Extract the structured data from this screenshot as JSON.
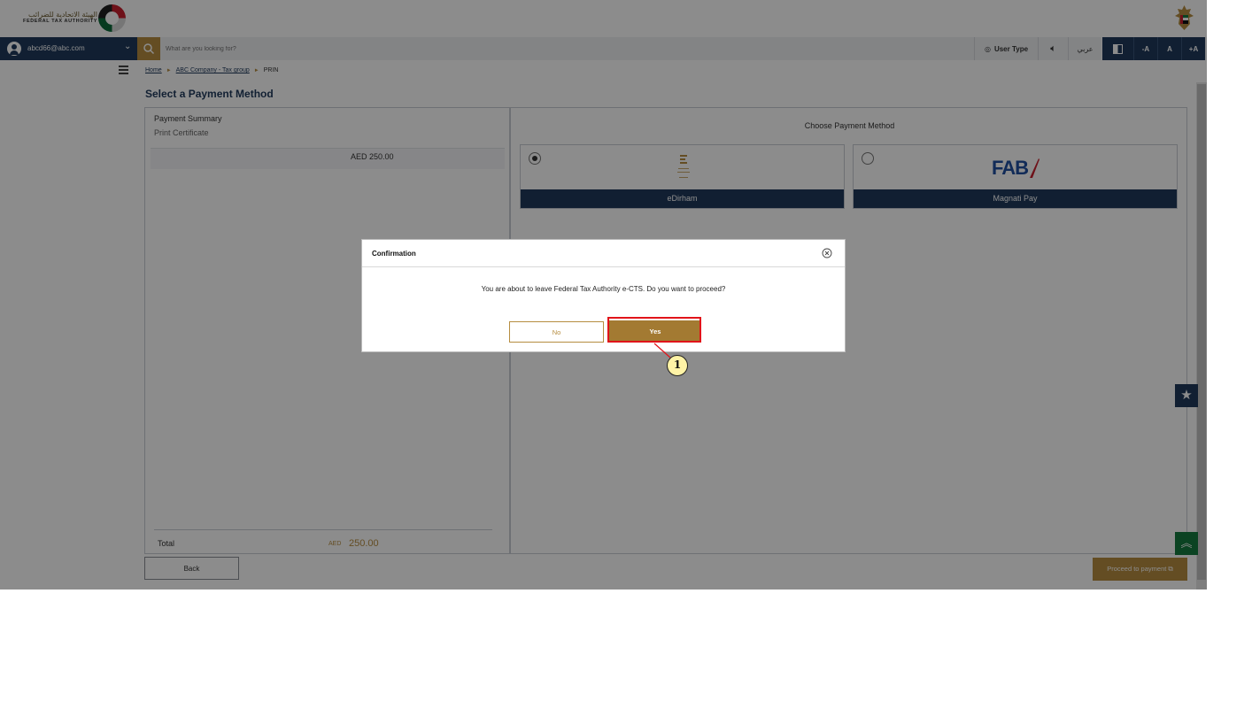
{
  "header": {
    "logo_arabic": "الهيئة الاتحادية للضرائب",
    "logo_english": "FEDERAL TAX AUTHORITY"
  },
  "navbar": {
    "user_email": "abcd66@abc.com",
    "search_placeholder": "What are you looking for?",
    "user_type_label": "User Type",
    "language_label": "عربي",
    "font_decrease": "-A",
    "font_normal": "A",
    "font_increase": "+A"
  },
  "breadcrumb": {
    "items": [
      "Home",
      "ABC Company - Tax group",
      "PRIN"
    ]
  },
  "page": {
    "title": "Select a Payment Method"
  },
  "summary": {
    "title": "Payment Summary",
    "subtitle": "Print Certificate",
    "amount": "AED 250.00",
    "total_label": "Total",
    "total_currency": "AED",
    "total_value": "250.00"
  },
  "methods": {
    "title": "Choose Payment Method",
    "options": [
      {
        "label": "eDirham",
        "selected": true,
        "logo": "edirham-logo"
      },
      {
        "label": "Magnati Pay",
        "selected": false,
        "logo": "fab-logo",
        "logo_text": "FAB"
      }
    ]
  },
  "actions": {
    "back_label": "Back",
    "proceed_label": "Proceed to payment"
  },
  "modal": {
    "title": "Confirmation",
    "message": "You are about to leave Federal Tax Authority e-CTS. Do you want to proceed?",
    "no_label": "No",
    "yes_label": "Yes"
  },
  "annotation": {
    "marker": "1"
  },
  "colors": {
    "navy": "#1f3a5c",
    "gold": "#b68d40",
    "highlight": "#e1141a",
    "green": "#157a3e"
  }
}
